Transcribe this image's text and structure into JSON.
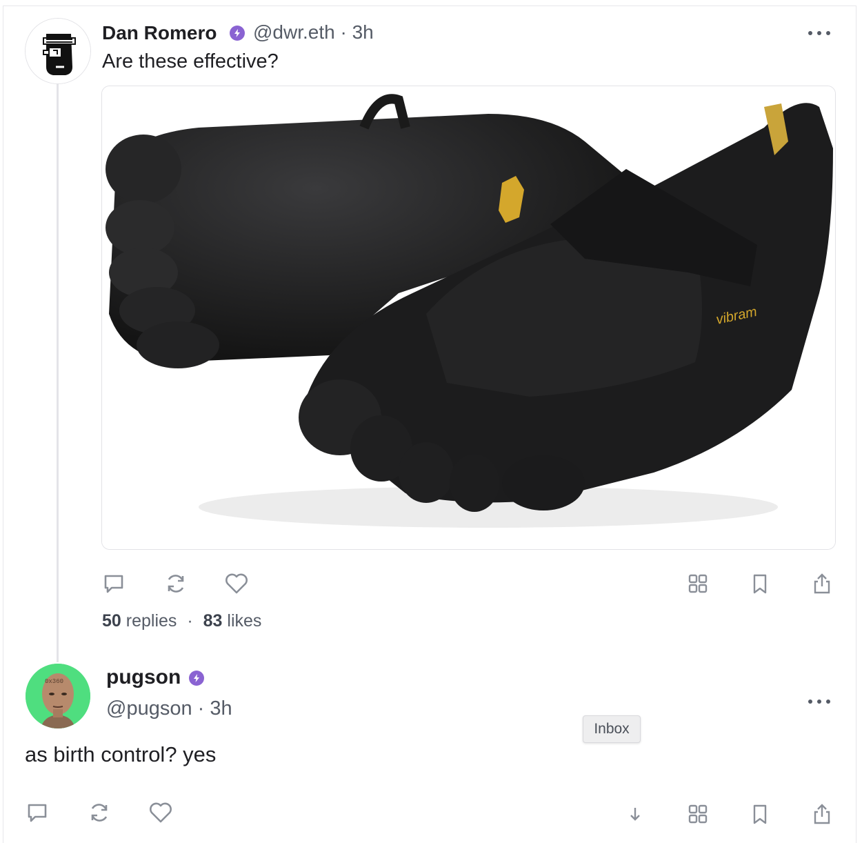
{
  "post": {
    "author_name": "Dan Romero",
    "author_handle_time": "@dwr.eth · 3h",
    "text": "Are these effective?",
    "image_alt": "Black five-toe shoes",
    "image_brand_text": "vibram",
    "replies_count": "50",
    "replies_label": "replies",
    "likes_count": "83",
    "likes_label": "likes",
    "separator": "·"
  },
  "reply": {
    "author_name": "pugson",
    "author_handle_time": "@pugson · 3h",
    "avatar_text": "0x360",
    "text": "as birth control? yes"
  },
  "tooltip": {
    "label": "Inbox"
  },
  "icons": {
    "reply": "comment-icon",
    "recast": "recast-icon",
    "like": "heart-icon",
    "apps": "grid-icon",
    "bookmark": "bookmark-icon",
    "share": "share-icon",
    "more": "more-horizontal-icon",
    "down": "arrow-down-icon",
    "verified": "power-badge-icon"
  },
  "colors": {
    "badge": "#8a63d2",
    "reply_avatar_bg": "#4fde7f",
    "icon_gray": "#8a8f98"
  }
}
